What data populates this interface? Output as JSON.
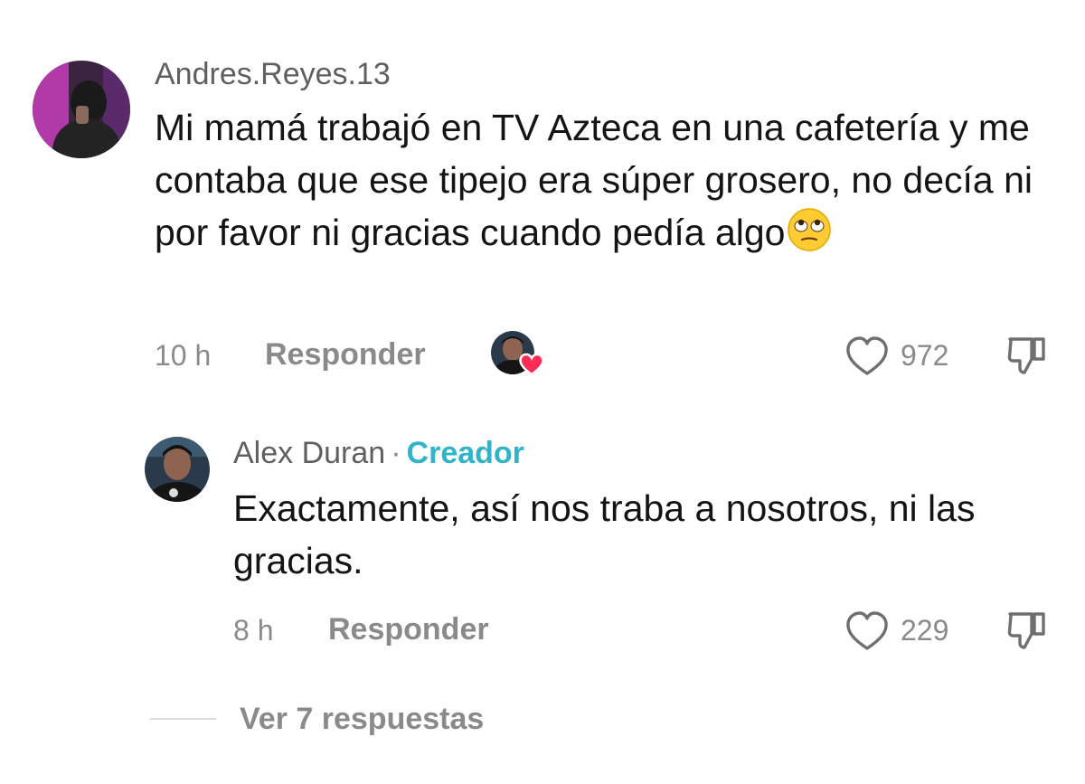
{
  "comments": [
    {
      "username": "Andres.Reyes.13",
      "text": "Mi mamá trabajó en TV Azteca en una cafetería y me contaba que ese tipejo era súper grosero, no decía ni por favor ni gracias cuando pedía algo",
      "emoji": "face-with-rolling-eyes",
      "time": "10 h",
      "reply_label": "Responder",
      "likes": "972",
      "creator_liked": true,
      "icons": {
        "like": "heart-outline-icon",
        "dislike": "thumbs-down-icon"
      }
    },
    {
      "username": "Alex Duran",
      "separator": "·",
      "badge": "Creador",
      "text": "Exactamente, así nos traba a nosotros, ni las gracias.",
      "time": "8 h",
      "reply_label": "Responder",
      "likes": "229",
      "icons": {
        "like": "heart-outline-icon",
        "dislike": "thumbs-down-icon"
      }
    }
  ],
  "view_replies": "Ver 7 respuestas",
  "colors": {
    "creator_badge": "#2fb4c9",
    "muted_text": "#8a8a8a",
    "body_text": "#141414",
    "heart_badge": "#fe2c55"
  }
}
